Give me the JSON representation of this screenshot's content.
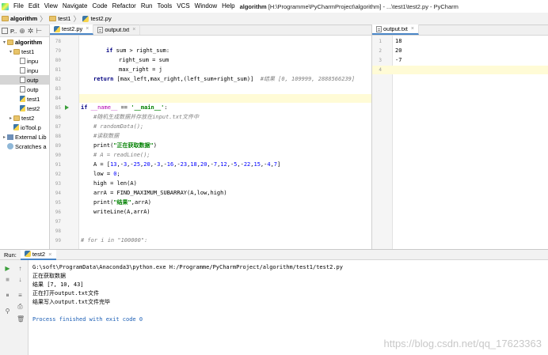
{
  "menubar": {
    "items": [
      "File",
      "Edit",
      "View",
      "Navigate",
      "Code",
      "Refactor",
      "Run",
      "Tools",
      "VCS",
      "Window",
      "Help"
    ],
    "title_project": "algorithm",
    "title_rest": "[H:\\Programme\\PyCharmProject\\algorithm] - ...\\test1\\test2.py - PyCharm"
  },
  "navbar": {
    "crumbs": [
      "algorithm",
      "test1",
      "test2.py"
    ]
  },
  "project": {
    "toolbar_label": "P..",
    "tree": [
      {
        "indent": 0,
        "arrow": "▾",
        "icon": "folder",
        "label": "algorithm",
        "bold": true
      },
      {
        "indent": 1,
        "arrow": "▾",
        "icon": "folder",
        "label": "test1"
      },
      {
        "indent": 2,
        "arrow": "",
        "icon": "txt",
        "label": "inpu"
      },
      {
        "indent": 2,
        "arrow": "",
        "icon": "txt",
        "label": "inpu"
      },
      {
        "indent": 2,
        "arrow": "",
        "icon": "txt",
        "label": "outp",
        "selected": true
      },
      {
        "indent": 2,
        "arrow": "",
        "icon": "txt",
        "label": "outp"
      },
      {
        "indent": 2,
        "arrow": "",
        "icon": "py",
        "label": "test1"
      },
      {
        "indent": 2,
        "arrow": "",
        "icon": "py",
        "label": "test2"
      },
      {
        "indent": 1,
        "arrow": "▸",
        "icon": "folder",
        "label": "test2"
      },
      {
        "indent": 1,
        "arrow": "",
        "icon": "py",
        "label": "ioTool.p"
      },
      {
        "indent": 0,
        "arrow": "▸",
        "icon": "lib",
        "label": "External Lib"
      },
      {
        "indent": 0,
        "arrow": "",
        "icon": "scratch",
        "label": "Scratches a"
      }
    ]
  },
  "editor": {
    "tabs": [
      {
        "label": "test2.py",
        "icon": "py",
        "active": true
      },
      {
        "label": "output.txt",
        "icon": "txt",
        "active": false
      }
    ],
    "close_glyph": "×"
  },
  "code_lines": [
    {
      "n": "78",
      "indent": 0,
      "text": ""
    },
    {
      "n": "79",
      "indent": 4,
      "html": "<span class='kw'>if</span> sum &gt; right_sum:"
    },
    {
      "n": "80",
      "indent": 6,
      "text": "right_sum = sum"
    },
    {
      "n": "81",
      "indent": 6,
      "text": "max_right = j"
    },
    {
      "n": "82",
      "indent": 2,
      "html": "<span class='kw'>return</span> [max_left,max_right,(left_sum+right_sum)]  <span class='cm'>#结果 [0, 109999, 2888566239]</span>"
    },
    {
      "n": "83",
      "indent": 0,
      "text": ""
    },
    {
      "n": "84",
      "indent": 0,
      "text": "",
      "current": true
    },
    {
      "n": "85",
      "indent": 0,
      "run": true,
      "html": "<span class='kw'>if</span> <span class='dd'>__name__</span> == <span class='st'>'__main__'</span>:"
    },
    {
      "n": "86",
      "indent": 2,
      "html": "<span class='cm'>#随机生成数据并存放在input.txt文件中</span>"
    },
    {
      "n": "87",
      "indent": 2,
      "html": "<span class='cm'># randomData();</span>"
    },
    {
      "n": "88",
      "indent": 2,
      "html": "<span class='cm'>#读取数据</span>"
    },
    {
      "n": "89",
      "indent": 2,
      "html": "print(<span class='st'>\"正在获取数据\"</span>)"
    },
    {
      "n": "90",
      "indent": 2,
      "html": "<span class='cm'># A = readLine();</span>"
    },
    {
      "n": "91",
      "indent": 2,
      "html": "A = [<span class='num'>13</span>,-<span class='num'>3</span>,-<span class='num'>25</span>,<span class='num'>20</span>,-<span class='num'>3</span>,-<span class='num'>16</span>,-<span class='num'>23</span>,<span class='num'>18</span>,<span class='num'>20</span>,-<span class='num'>7</span>,<span class='num'>12</span>,-<span class='num'>5</span>,-<span class='num'>22</span>,<span class='num'>15</span>,-<span class='num'>4</span>,<span class='num'>7</span>]"
    },
    {
      "n": "92",
      "indent": 2,
      "html": "low = <span class='num'>0</span>;"
    },
    {
      "n": "93",
      "indent": 2,
      "text": "high = len(A)"
    },
    {
      "n": "94",
      "indent": 2,
      "text": "arrA = FIND_MAXIMUM_SUBARRAY(A,low,high)"
    },
    {
      "n": "95",
      "indent": 2,
      "html": "print(<span class='st'>\"结果\"</span>,arrA)"
    },
    {
      "n": "96",
      "indent": 2,
      "text": "writeLine(A,arrA)"
    },
    {
      "n": "97",
      "indent": 0,
      "text": ""
    },
    {
      "n": "98",
      "indent": 0,
      "text": ""
    },
    {
      "n": "99",
      "indent": 0,
      "html": "<span class='cm'># for i in \"100000\":</span>"
    }
  ],
  "output_file": {
    "tab": "output.txt",
    "lines": [
      {
        "n": "1",
        "text": "18"
      },
      {
        "n": "2",
        "text": "20"
      },
      {
        "n": "3",
        "text": "-7"
      },
      {
        "n": "4",
        "text": "",
        "current": true
      }
    ]
  },
  "run": {
    "label": "Run:",
    "tab": "test2",
    "console": [
      {
        "cls": "path",
        "text": "G:\\soft\\ProgramData\\Anaconda3\\python.exe H:/Programme/PyCharmProject/algorithm/test1/test2.py"
      },
      {
        "cls": "",
        "text": "正在获取数据"
      },
      {
        "cls": "",
        "text": "结果 [7, 10, 43]"
      },
      {
        "cls": "",
        "text": "正在打开output.txt文件"
      },
      {
        "cls": "",
        "text": "结果写入output.txt文件完毕"
      },
      {
        "cls": "",
        "text": ""
      },
      {
        "cls": "exit",
        "text": "Process finished with exit code 0"
      }
    ]
  },
  "watermark": "https://blog.csdn.net/qq_17623363"
}
